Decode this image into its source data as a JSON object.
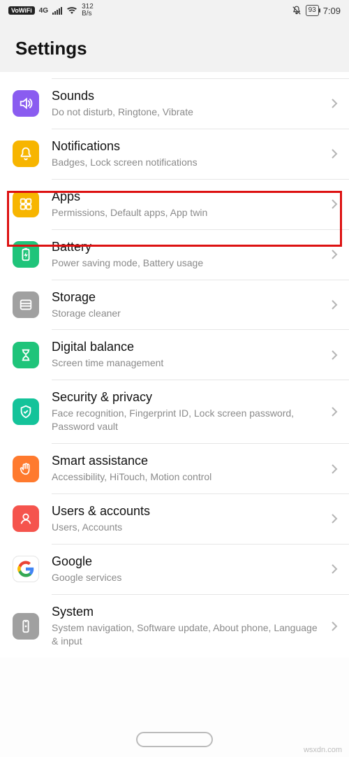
{
  "status": {
    "vowifi": "VoWiFi",
    "net": "4G",
    "rate_top": "312",
    "rate_bot": "B/s",
    "battery": "93",
    "time": "7:09"
  },
  "header": {
    "title": "Settings"
  },
  "rows": {
    "sounds": {
      "title": "Sounds",
      "sub": "Do not disturb, Ringtone, Vibrate"
    },
    "notif": {
      "title": "Notifications",
      "sub": "Badges, Lock screen notifications"
    },
    "apps": {
      "title": "Apps",
      "sub": "Permissions, Default apps, App twin"
    },
    "battery": {
      "title": "Battery",
      "sub": "Power saving mode, Battery usage"
    },
    "storage": {
      "title": "Storage",
      "sub": "Storage cleaner"
    },
    "digital": {
      "title": "Digital balance",
      "sub": "Screen time management"
    },
    "security": {
      "title": "Security & privacy",
      "sub": "Face recognition, Fingerprint ID, Lock screen password, Password vault"
    },
    "smart": {
      "title": "Smart assistance",
      "sub": "Accessibility, HiTouch, Motion control"
    },
    "users": {
      "title": "Users & accounts",
      "sub": "Users, Accounts"
    },
    "google": {
      "title": "Google",
      "sub": "Google services"
    },
    "system": {
      "title": "System",
      "sub": "System navigation, Software update, About phone, Language & input"
    }
  },
  "watermark": "wsxdn.com"
}
